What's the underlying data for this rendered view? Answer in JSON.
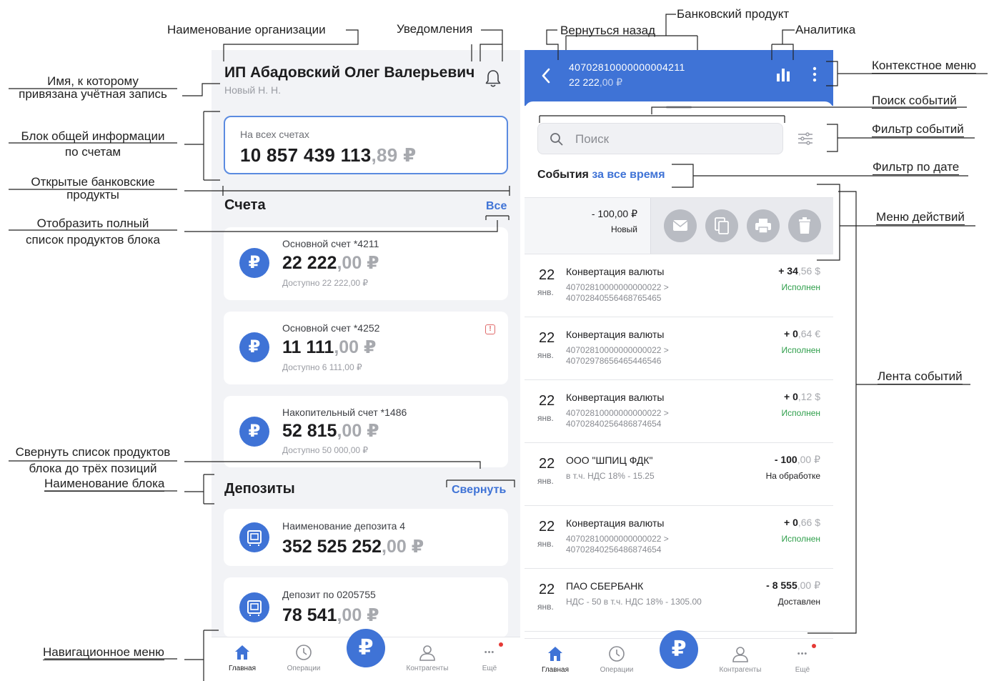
{
  "annotations": {
    "org_name": "Наименование организации",
    "notifications": "Уведомления",
    "bank_product": "Банковский продукт",
    "back": "Вернуться назад",
    "analytics": "Аналитика",
    "context_menu": "Контекстное меню",
    "event_search": "Поиск событий",
    "event_filter": "Фильтр событий",
    "date_filter": "Фильтр по дате",
    "actions_menu": "Меню действий",
    "event_feed": "Лента событий",
    "account_name_1": "Имя, к которому",
    "account_name_2": "привязана учётная запись",
    "general_info_1": "Блок общей информации",
    "general_info_2": "по счетам",
    "open_products_1": "Открытые банковские",
    "open_products_2": "продукты",
    "show_full_1": "Отобразить полный",
    "show_full_2": "список продуктов блока",
    "collapse_1": "Свернуть список продуктов",
    "collapse_2": "блока до трёх позиций",
    "block_name": "Наименование блока",
    "nav_menu": "Навигационное меню"
  },
  "left": {
    "org_name": "ИП Абадовский Олег Валерьевич",
    "user_name": "Новый Н. Н.",
    "total": {
      "label": "На всех счетах",
      "int": "10 857 439 113",
      "frac": ",89 ₽"
    },
    "accounts_section": {
      "title": "Счета",
      "link": "Все"
    },
    "accounts": [
      {
        "name": "Основной счет *4211",
        "int": "22 222",
        "frac": ",00 ₽",
        "avail": "Доступно 22 222,00 ₽",
        "icon": "₽"
      },
      {
        "name": "Основной счет *4252",
        "int": "11 111",
        "frac": ",00 ₽",
        "avail": "Доступно 6 111,00 ₽",
        "icon": "₽",
        "warn": "!"
      },
      {
        "name": "Накопительный счет *1486",
        "int": "52 815",
        "frac": ",00 ₽",
        "avail": "Доступно 50 000,00 ₽",
        "icon": "₽"
      }
    ],
    "deposits_section": {
      "title": "Депозиты",
      "link": "Свернуть"
    },
    "deposits": [
      {
        "name": "Наименование депозита 4",
        "int": "352 525 252",
        "frac": ",00 ₽"
      },
      {
        "name": "Депозит по 0205755",
        "int": "78 541",
        "frac": ",00 ₽"
      }
    ]
  },
  "nav": {
    "home": "Главная",
    "operations": "Операции",
    "fab": "₽",
    "contractors": "Контрагенты",
    "more": "Ещё",
    "more_glyph": "•••"
  },
  "right": {
    "header": {
      "account": "40702810000000004211",
      "bal_int": "22 222",
      "bal_frac": ",00 ₽"
    },
    "search_placeholder": "Поиск",
    "events_title": "События",
    "events_period": "за все время",
    "action_row": {
      "amount": "- 100,00 ₽",
      "status": "Новый"
    },
    "events": [
      {
        "day": "22",
        "month": "янв.",
        "title": "Конвертация валюты",
        "sub1": "40702810000000000022 >",
        "sub2": "40702840556468765465",
        "amt": "+ 34",
        "frac": ",56 $",
        "status": "Исполнен",
        "status_color": "#2e9e4a"
      },
      {
        "day": "22",
        "month": "янв.",
        "title": "Конвертация валюты",
        "sub1": "40702810000000000022 >",
        "sub2": "40702978656465446546",
        "amt": "+ 0",
        "frac": ",64 €",
        "status": "Исполнен",
        "status_color": "#2e9e4a"
      },
      {
        "day": "22",
        "month": "янв.",
        "title": "Конвертация валюты",
        "sub1": "40702810000000000022 >",
        "sub2": "40702840256486874654",
        "amt": "+ 0",
        "frac": ",12 $",
        "status": "Исполнен",
        "status_color": "#2e9e4a"
      },
      {
        "day": "22",
        "month": "янв.",
        "title": "ООО \"ШПИЦ ФДК\"",
        "sub1": "в т.ч. НДС 18% - 15.25",
        "sub2": "",
        "amt": "- 100",
        "frac": ",00 ₽",
        "status": "На обработке",
        "status_color": "#1d1d1f"
      },
      {
        "day": "22",
        "month": "янв.",
        "title": "Конвертация валюты",
        "sub1": "40702810000000000022 >",
        "sub2": "40702840256486874654",
        "amt": "+ 0",
        "frac": ",66 $",
        "status": "Исполнен",
        "status_color": "#2e9e4a"
      },
      {
        "day": "22",
        "month": "янв.",
        "title": "ПАО СБЕРБАНК",
        "sub1": "НДС - 50 в т.ч. НДС 18% - 1305.00",
        "sub2": "",
        "amt": "- 8 555",
        "frac": ",00 ₽",
        "status": "Доставлен",
        "status_color": "#1d1d1f"
      }
    ]
  },
  "colors": {
    "accent": "#3f73d6",
    "success": "#2e9e4a",
    "background": "#f2f3f6"
  }
}
